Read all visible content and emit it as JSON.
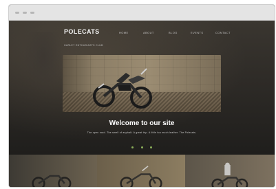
{
  "site": {
    "logo": "POLECATS",
    "nav": [
      "HOME",
      "ABOUT",
      "BLOG",
      "EVENTS",
      "CONTACT"
    ],
    "tagline": "HARLEY ENTHUSIASTS CLUB"
  },
  "hero": {
    "title": "Welcome to our site",
    "subtitle": "The open road. The smell of asphalt. A great trip. A little too much leather. The Polecats."
  },
  "social": {
    "icons": [
      "facebook-icon",
      "twitter-icon",
      "youtube-icon"
    ]
  },
  "colors": {
    "background": "#2a2a2a",
    "accent": "#8cae5a",
    "heading": "#ffffff"
  }
}
